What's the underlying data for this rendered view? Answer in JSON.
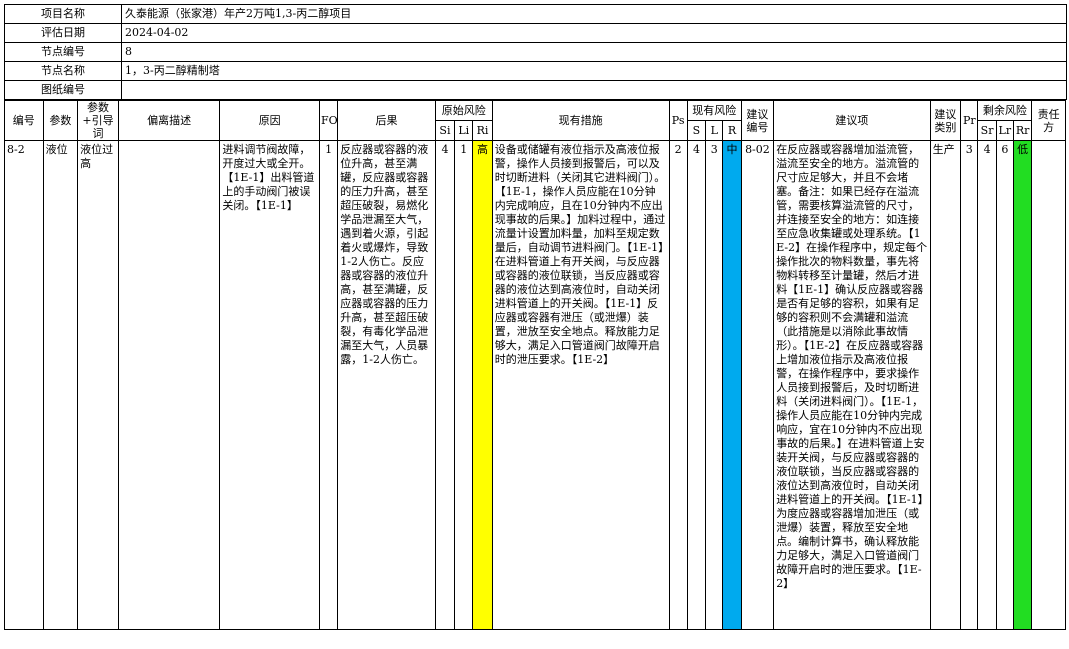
{
  "info": {
    "project_name_label": "项目名称",
    "project_name": "久泰能源（张家港）年产2万吨1,3-丙二醇项目",
    "eval_date_label": "评估日期",
    "eval_date": "2024-04-02",
    "node_no_label": "节点编号",
    "node_no": "8",
    "node_name_label": "节点名称",
    "node_name": "1，3-丙二醇精制塔",
    "drawing_no_label": "图纸编号",
    "drawing_no": ""
  },
  "headers": {
    "no": "编号",
    "param": "参数",
    "param_guide": "参数+引导词",
    "deviation": "偏离描述",
    "cause": "原因",
    "fop": "FOP",
    "consequence": "后果",
    "orig_risk": "原始风险",
    "si": "Si",
    "li": "Li",
    "ri": "Ri",
    "measures": "现有措施",
    "ps": "Ps",
    "curr_risk": "现有风险",
    "s": "S",
    "l": "L",
    "r": "R",
    "rec_no": "建议编号",
    "rec": "建议项",
    "rec_type": "建议类别",
    "pr": "Pr",
    "resid_risk": "剩余风险",
    "sr": "Sr",
    "lr": "Lr",
    "rr": "Rr",
    "owner": "责任方"
  },
  "row": {
    "no": "8-2",
    "param": "液位",
    "param_guide": "液位过高",
    "deviation": "",
    "cause": "进料调节阀故障，开度过大或全开。【1E-1】出料管道上的手动阀门被误关闭。【1E-1】",
    "fop": "1",
    "consequence": "反应器或容器的液位升高，甚至满罐，反应器或容器的压力升高，甚至超压破裂，易燃化学品泄漏至大气，遇到着火源，引起着火或爆炸，导致1-2人伤亡。反应器或容器的液位升高，甚至满罐，反应器或容器的压力升高，甚至超压破裂，有毒化学品泄漏至大气，人员暴露，1-2人伤亡。",
    "si": "4",
    "li": "1",
    "ri": "高",
    "measures": "设备或储罐有液位指示及高液位报警，操作人员接到报警后，可以及时切断进料（关闭其它进料阀门）。【1E-1，操作人员应能在10分钟内完成响应，且在10分钟内不应出现事故的后果。】加料过程中，通过流量计设置加料量，加料至规定数量后，自动调节进料阀门。【1E-1】在进料管道上有开关阀，与反应器或容器的液位联锁，当反应器或容器的液位达到高液位时，自动关闭进料管道上的开关阀。【1E-1】反应器或容器有泄压（或泄爆）装置，泄放至安全地点。释放能力足够大，满足入口管道阀门故障开启时的泄压要求。【1E-2】",
    "ps": "2",
    "s": "4",
    "l": "3",
    "r": "中",
    "rec_no": "8-02",
    "rec": "在反应器或容器增加溢流管，溢流至安全的地方。溢流管的尺寸应足够大，并且不会堵塞。备注：如果已经存在溢流管，需要核算溢流管的尺寸，并连接至安全的地方：如连接至应急收集罐或处理系统。【1E-2】在操作程序中，规定每个操作批次的物料数量，事先将物料转移至计量罐，然后才进料【1E-1】确认反应器或容器是否有足够的容积，如果有足够的容积则不会满罐和溢流（此措施是以消除此事故情形）。【1E-2】在反应器或容器上增加液位指示及高液位报警，在操作程序中，要求操作人员接到报警后，及时切断进料（关闭进料阀门）。【1E-1，操作人员应能在10分钟内完成响应，宜在10分钟内不应出现事故的后果。】在进料管道上安装开关阀，与反应器或容器的液位联锁，当反应器或容器的液位达到高液位时，自动关闭进料管道上的开关阀。【1E-1】为度应器或容器增加泄压（或泄爆）装置，释放至安全地点。编制计算书，确认释放能力足够大，满足入口管道阀门故障开启时的泄压要求。【1E-2】",
    "rec_type": "生产",
    "pr": "3",
    "sr": "4",
    "lr": "6",
    "rr": "低",
    "owner": ""
  },
  "colors": {
    "ri_high": "#ffff00",
    "r_medium": "#00aaee",
    "rr_low": "#22dd22"
  }
}
